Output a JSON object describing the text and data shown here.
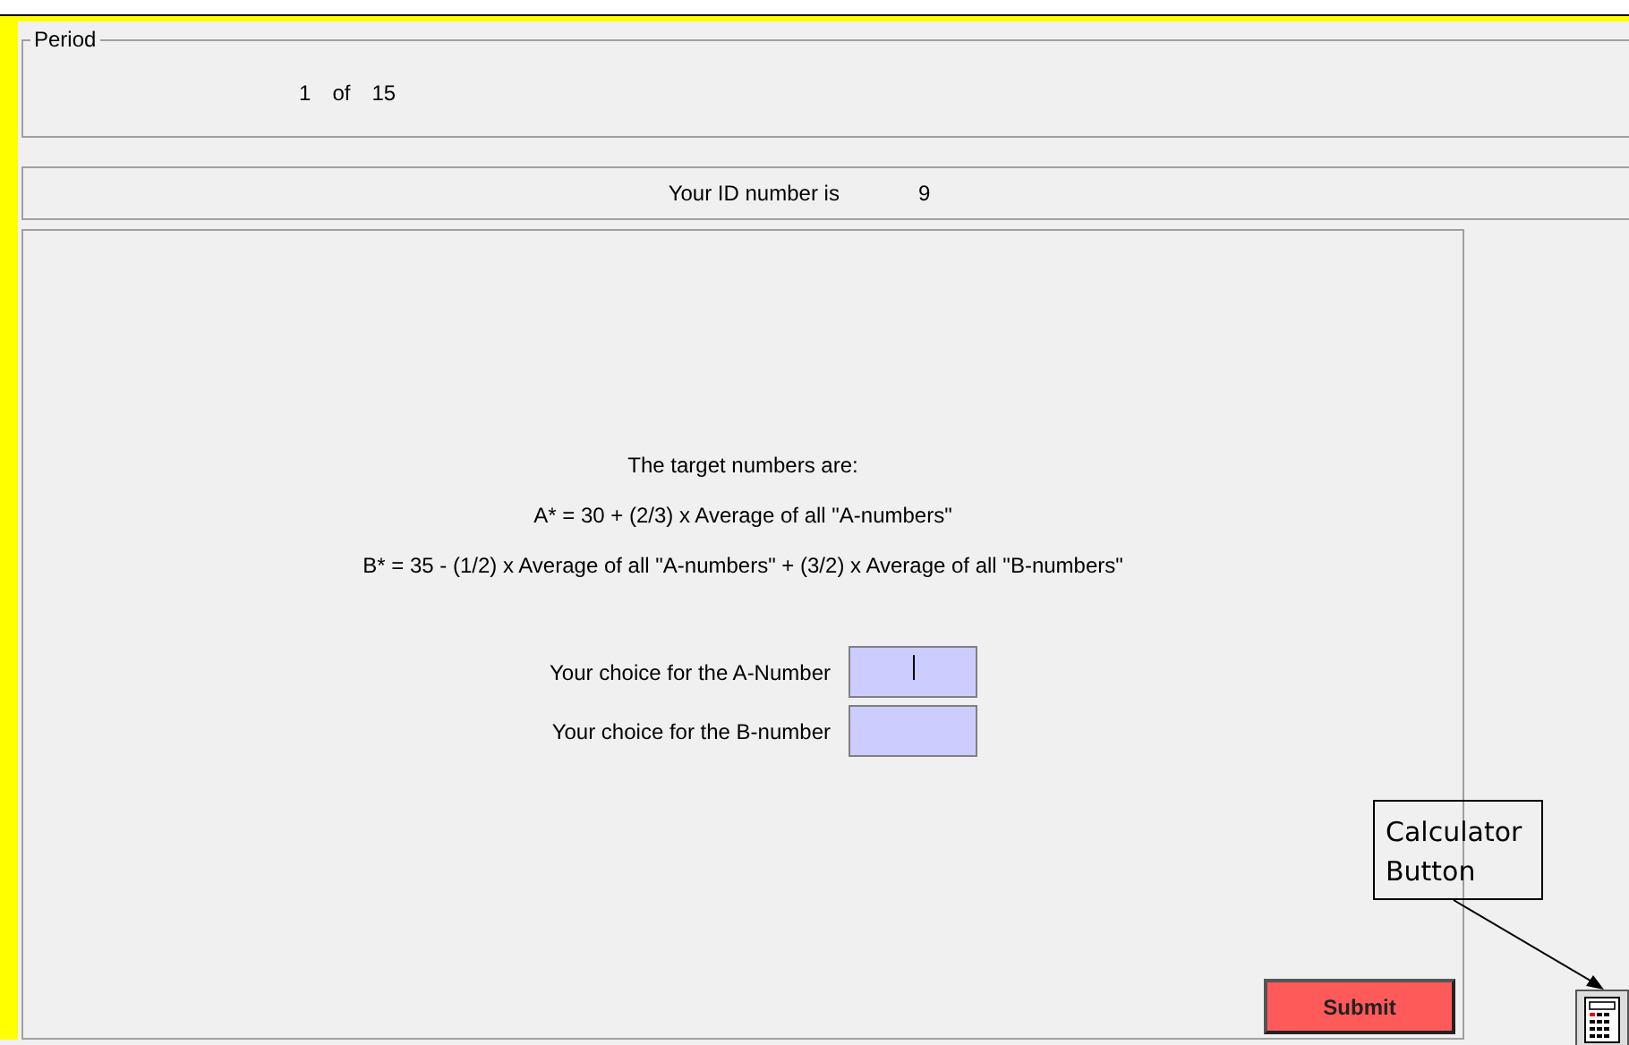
{
  "period": {
    "legend": "Period",
    "current": "1",
    "of": "of",
    "total": "15"
  },
  "id_line": {
    "label": "Your ID number is",
    "value": "9"
  },
  "instructions": {
    "heading": "The target numbers are:",
    "lines": [
      "A* = 30 + (2/3) x Average of all \"A-numbers\"",
      "B* = 35 - (1/2) x Average of all \"A-numbers\" + (3/2) x Average of all \"B-numbers\""
    ]
  },
  "fields": [
    {
      "label": "Your choice for the A-Number",
      "focused": true
    },
    {
      "label": "Your choice for the B-number",
      "focused": false
    }
  ],
  "submit_button": "Submit",
  "callout": "Calculator Button"
}
